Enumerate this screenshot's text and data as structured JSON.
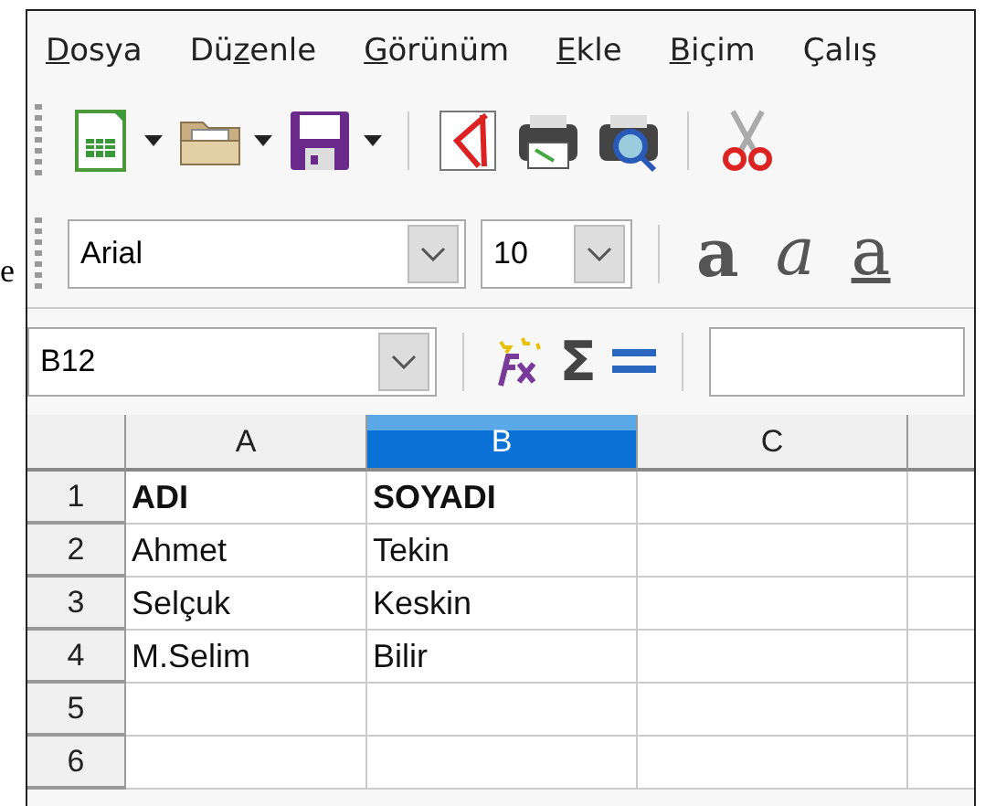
{
  "stray_text": "e",
  "menu": [
    {
      "key": "D",
      "post": "osya"
    },
    {
      "pre": "Dü",
      "key": "z",
      "post": "enle"
    },
    {
      "key": "G",
      "post": "örünüm"
    },
    {
      "key": "E",
      "post": "kle"
    },
    {
      "key": "B",
      "post": "içim"
    },
    {
      "pre": "Çalış"
    }
  ],
  "toolbar": [
    {
      "kind": "spreadsheet",
      "dropdown": true
    },
    {
      "kind": "folder",
      "dropdown": true
    },
    {
      "kind": "save",
      "dropdown": true
    },
    {
      "kind": "separator"
    },
    {
      "kind": "pdf",
      "dropdown": false
    },
    {
      "kind": "print",
      "dropdown": false
    },
    {
      "kind": "preview",
      "dropdown": false
    },
    {
      "kind": "separator"
    },
    {
      "kind": "cut",
      "dropdown": false
    }
  ],
  "font_name": "Arial",
  "font_size": "10",
  "format_buttons": [
    {
      "kind": "bold",
      "glyph": "a"
    },
    {
      "kind": "italic",
      "glyph": "a"
    },
    {
      "kind": "underline",
      "glyph": "a"
    }
  ],
  "name_box": "B12",
  "sum_glyph": "Σ",
  "columns": [
    {
      "label": "A",
      "selected": false
    },
    {
      "label": "B",
      "selected": true
    },
    {
      "label": "C",
      "selected": false
    }
  ],
  "rows": [
    {
      "number": "1",
      "bold": true,
      "cells": [
        "ADI",
        "SOYADI"
      ]
    },
    {
      "number": "2",
      "bold": false,
      "cells": [
        "Ahmet",
        "Tekin"
      ]
    },
    {
      "number": "3",
      "bold": false,
      "cells": [
        "Selçuk",
        "Keskin"
      ]
    },
    {
      "number": "4",
      "bold": false,
      "cells": [
        "M.Selim",
        "Bilir"
      ]
    },
    {
      "number": "5",
      "cells": []
    },
    {
      "number": "6",
      "cells": []
    }
  ]
}
